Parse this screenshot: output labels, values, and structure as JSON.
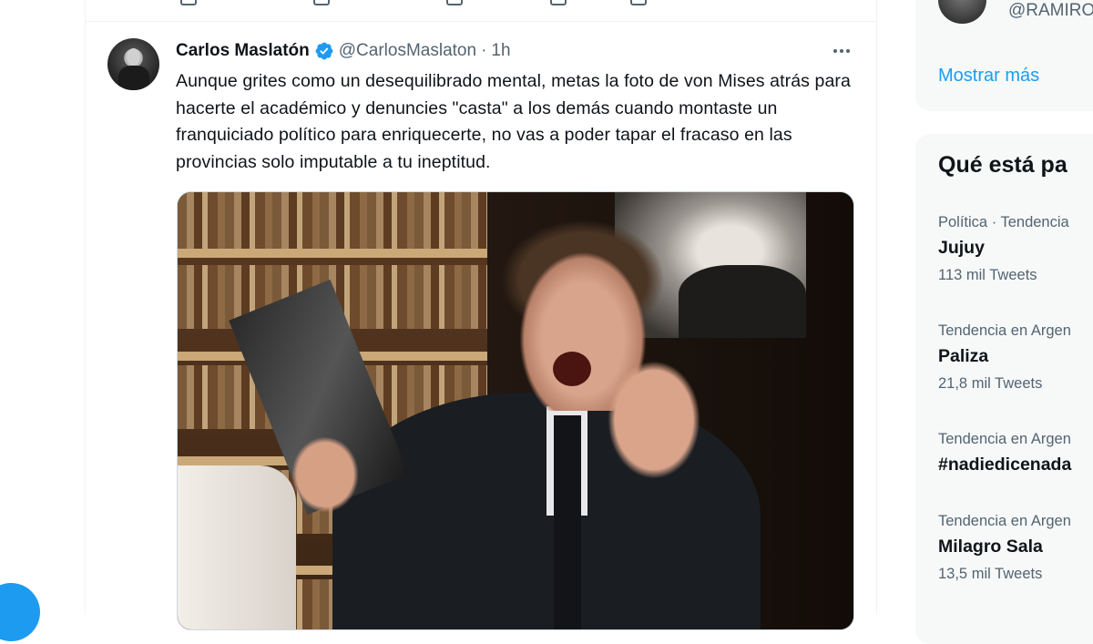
{
  "tweet": {
    "author_name": "Carlos Maslatón",
    "handle": "@CarlosMaslaton",
    "separator": "·",
    "time": "1h",
    "text": "Aunque grites como un desequilibrado mental, metas la foto de von Mises atrás para hacerte el académico y denuncies \"casta\" a los demás cuando montaste un franquiciado político para enriquecerte, no vas a poder tapar el fracaso en las provincias solo imputable a tu ineptitud."
  },
  "sidebar": {
    "who_to_follow_handle": "@RAMIRO",
    "show_more": "Mostrar más",
    "trends_title": "Qué está pa",
    "trends": [
      {
        "meta": "Política · Tendencia",
        "name": "Jujuy",
        "count": "113 mil Tweets"
      },
      {
        "meta": "Tendencia en Argen",
        "name": "Paliza",
        "count": "21,8 mil Tweets"
      },
      {
        "meta": "Tendencia en Argen",
        "name": "#nadiedicenada",
        "count": ""
      },
      {
        "meta": "Tendencia en Argen",
        "name": "Milagro Sala",
        "count": "13,5 mil Tweets"
      }
    ]
  },
  "colors": {
    "accent": "#1d9bf0",
    "text": "#0f1419",
    "secondary": "#536471"
  }
}
